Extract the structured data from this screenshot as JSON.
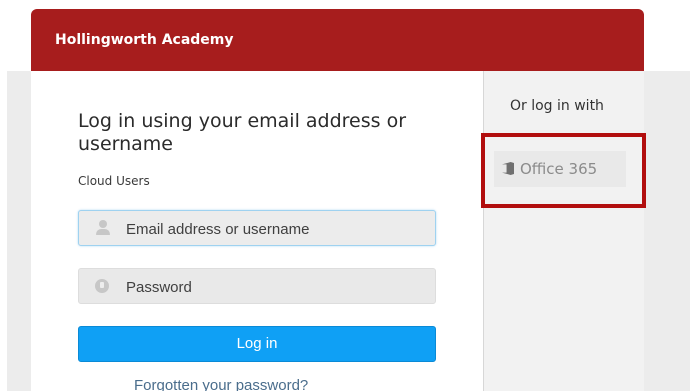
{
  "brand": {
    "name": "Hollingworth Academy",
    "header_color": "#a71d1d"
  },
  "login": {
    "heading": "Log in using your email address or username",
    "subheading": "Cloud Users",
    "email_placeholder": "Email address or username",
    "password_placeholder": "Password",
    "submit_label": "Log in",
    "forgot_link": "Forgotten your password?",
    "button_color": "#0fa0f5"
  },
  "alternate": {
    "title": "Or log in with",
    "provider_label": "Office 365",
    "provider_icon": "office-icon",
    "highlight_color": "#b20e0e"
  },
  "icons": {
    "email_field_icon": "user-icon",
    "password_field_icon": "lock-icon"
  }
}
